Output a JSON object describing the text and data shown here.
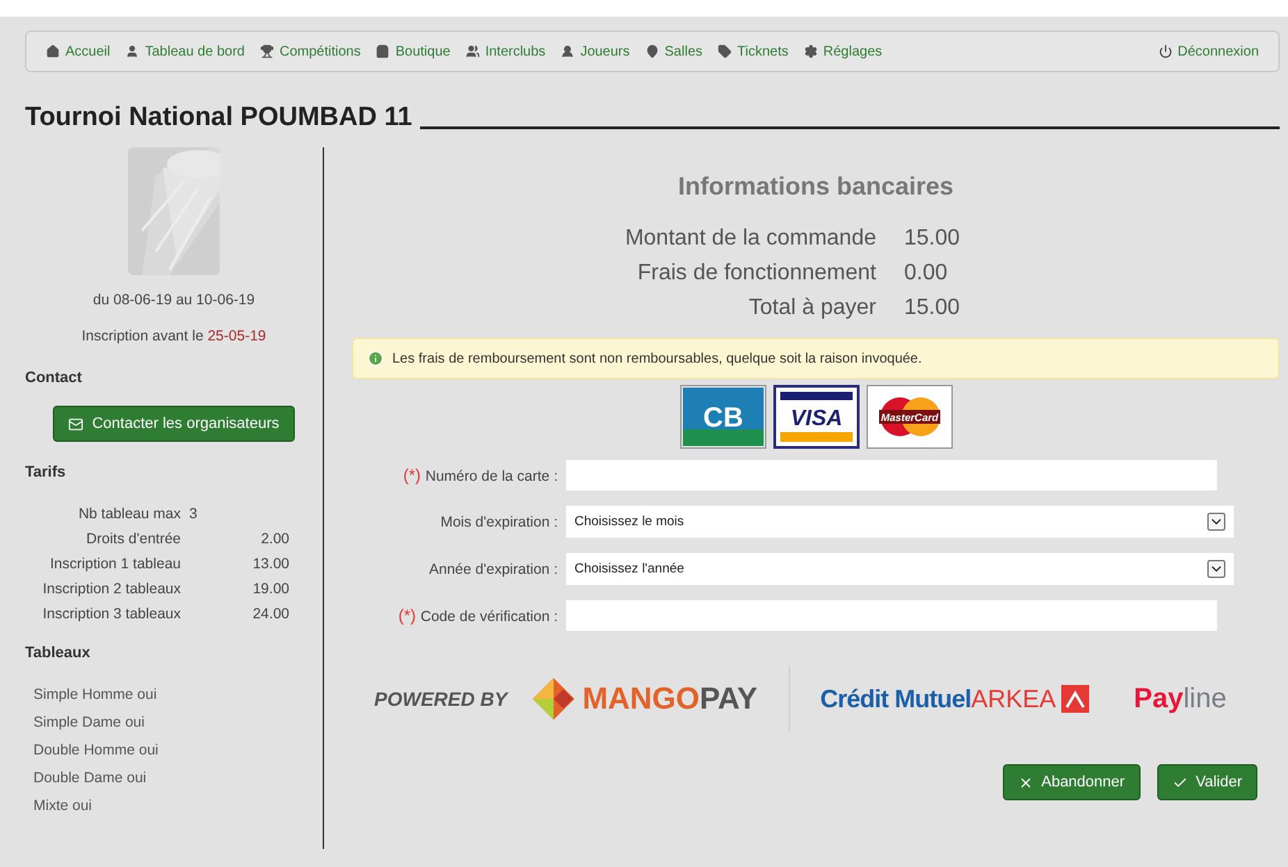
{
  "nav": {
    "items": [
      {
        "label": "Accueil"
      },
      {
        "label": "Tableau de bord"
      },
      {
        "label": "Compétitions"
      },
      {
        "label": "Boutique"
      },
      {
        "label": "Interclubs"
      },
      {
        "label": "Joueurs"
      },
      {
        "label": "Salles"
      },
      {
        "label": "Ticknets"
      },
      {
        "label": "Réglages"
      }
    ],
    "logout": "Déconnexion"
  },
  "title": "Tournoi National POUMBAD 11",
  "sidebar": {
    "dates": "du 08-06-19 au 10-06-19",
    "deadline_label": "Inscription avant le",
    "deadline": "25-05-19",
    "contact_heading": "Contact",
    "contact_button": "Contacter les organisateurs",
    "tarifs_heading": "Tarifs",
    "tarifs": [
      {
        "kind": "count",
        "label": "Nb tableau max",
        "value": "3"
      },
      {
        "kind": "price",
        "label": "Droits d'entrée",
        "value": "2.00"
      },
      {
        "kind": "price",
        "label": "Inscription 1 tableau",
        "value": "13.00"
      },
      {
        "kind": "price",
        "label": "Inscription 2 tableaux",
        "value": "19.00"
      },
      {
        "kind": "price",
        "label": "Inscription 3 tableaux",
        "value": "24.00"
      }
    ],
    "tableaux_heading": "Tableaux",
    "tableaux": [
      "Simple Homme oui",
      "Simple Dame oui",
      "Double Homme oui",
      "Double Dame oui",
      "Mixte oui"
    ]
  },
  "payment": {
    "heading": "Informations bancaires",
    "amounts": [
      {
        "label": "Montant de la commande",
        "value": "15.00"
      },
      {
        "label": "Frais de fonctionnement",
        "value": "0.00"
      },
      {
        "label": "Total à payer",
        "value": "15.00"
      }
    ],
    "notice": "Les frais de remboursement sont non remboursables, quelque soit la raison invoquée.",
    "cards": [
      {
        "kind": "cb",
        "label": "CB",
        "selected": false
      },
      {
        "kind": "visa",
        "label": "VISA",
        "selected": true
      },
      {
        "kind": "mastercard",
        "label": "MasterCard",
        "selected": false
      }
    ],
    "fields": [
      {
        "kind": "text",
        "required": true,
        "label": "Numéro de la carte :"
      },
      {
        "kind": "select",
        "required": false,
        "label": "Mois d'expiration :",
        "value": "Choisissez le mois"
      },
      {
        "kind": "select",
        "required": false,
        "label": "Année d'expiration :",
        "value": "Choisissez l'année"
      },
      {
        "kind": "text",
        "required": true,
        "label": "Code de vérification :"
      }
    ],
    "required_mark": "(*)",
    "partners": {
      "powered_by": "POWERED BY",
      "mango_1": "MANGO",
      "mango_2": "PAY",
      "cm": "Crédit Mutuel",
      "arkea": "ARKEA",
      "payline_1": "Pay",
      "payline_2": "line"
    },
    "buttons": [
      {
        "kind": "cancel",
        "label": "Abandonner"
      },
      {
        "kind": "ok",
        "label": "Valider"
      }
    ]
  }
}
